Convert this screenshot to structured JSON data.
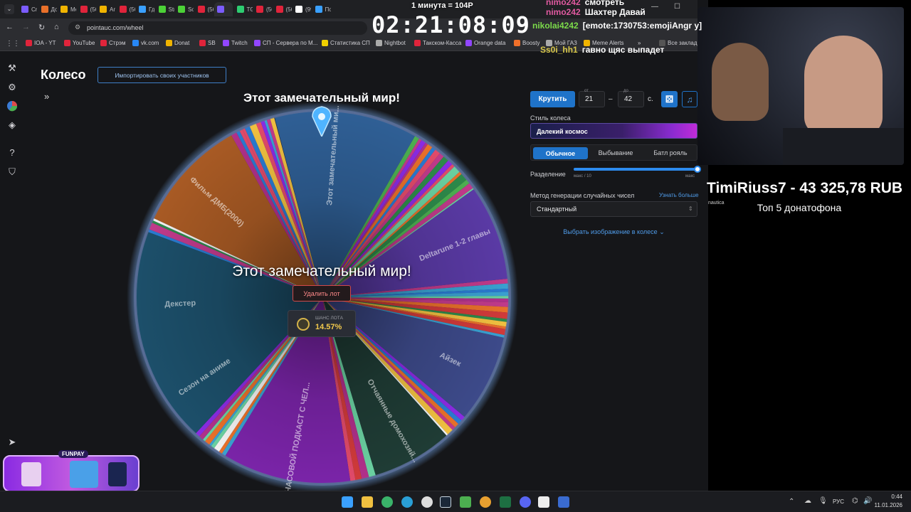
{
  "browser": {
    "tabs": [
      {
        "label": "Crea",
        "color": "#7b5cff"
      },
      {
        "label": "Дон",
        "color": "#e8702a"
      },
      {
        "label": "Mem",
        "color": "#f0b400"
      },
      {
        "label": "(56)",
        "color": "#e0243b"
      },
      {
        "label": "Amn",
        "color": "#f0b400"
      },
      {
        "label": "(56)",
        "color": "#e0243b"
      },
      {
        "label": "Где с",
        "color": "#3aa0ff"
      },
      {
        "label": "Strea",
        "color": "#4cd137"
      },
      {
        "label": "Sopi",
        "color": "#4cd137"
      },
      {
        "label": "(56)",
        "color": "#e0243b"
      },
      {
        "label": "",
        "color": "#7b5cff"
      },
      {
        "label": "TG",
        "color": "#2ecc71"
      },
      {
        "label": "(56)",
        "color": "#e0243b"
      },
      {
        "label": "(56)",
        "color": "#e0243b"
      },
      {
        "label": "(99+",
        "color": "#ffffff"
      },
      {
        "label": "Пол",
        "color": "#3aa0ff"
      }
    ],
    "url": "pointauc.com/wheel",
    "bookmarks": [
      {
        "label": "IOA - YT",
        "color": "#e0243b"
      },
      {
        "label": "YouTube",
        "color": "#e0243b"
      },
      {
        "label": "Стрэм",
        "color": "#e0243b"
      },
      {
        "label": "vk.com",
        "color": "#2787f5"
      },
      {
        "label": "Donat",
        "color": "#f0b400"
      },
      {
        "label": "SB",
        "color": "#e0243b"
      },
      {
        "label": "Twitch",
        "color": "#9146ff"
      },
      {
        "label": "СП - Сервера по М...",
        "color": "#9146ff"
      },
      {
        "label": "Статистика СП",
        "color": "#f0d000"
      },
      {
        "label": "Nightbot",
        "color": "#aaaaaa"
      },
      {
        "label": "Такском-Касса",
        "color": "#e0243b"
      },
      {
        "label": "Orange data",
        "color": "#9146ff"
      },
      {
        "label": "Boosty",
        "color": "#f0702a"
      },
      {
        "label": "Мой ГАЗ",
        "color": "#aaaaaa"
      },
      {
        "label": "Meme Alerts",
        "color": "#f0b400"
      }
    ],
    "bookmarks_all": "Все заклад"
  },
  "rail": {
    "icons": [
      "gavel-icon",
      "gear-icon",
      "wheel-icon",
      "layers-icon",
      "help-icon",
      "shield-icon",
      "telegram-icon"
    ]
  },
  "header": {
    "title": "Колесо",
    "import_button": "Импортировать своих участников",
    "expand_icon": "»"
  },
  "wheel": {
    "winner_top": "Этот замечательный мир!",
    "winner_center": "Этот замечательный мир!",
    "delete_button": "Удалить лот",
    "chance_label": "ШАНС ЛОТА",
    "chance_value": "14.57%",
    "segment_labels": [
      "Этот замечательный ми...",
      "Deltarune 1-2 главы",
      "Айзек",
      "Отчаянные домохозяй...",
      "ЧАСОВОЙ ПОДКАСТ С ЧЕЛ...",
      "Сезон на аниме",
      "Декстер",
      "Фильм ДМБ(2000)"
    ]
  },
  "controls": {
    "spin_button": "Крутить",
    "from_label": "от",
    "from_value": "21",
    "dash": "–",
    "to_label": "до",
    "to_value": "42",
    "seconds": "с.",
    "dice_icon": "dice-icon",
    "music_icon": "music-icon",
    "style_label": "Стиль колеса",
    "style_value": "Далекий космос",
    "modes": [
      "Обычное",
      "Выбывание",
      "Батл рояль"
    ],
    "active_mode": "Обычное",
    "split_label": "Разделение",
    "split_min": "макс / 10",
    "split_max": "макс",
    "split_value": 1.0,
    "rng_label": "Метод генерации случайных чисел",
    "rng_more": "Узнать больше",
    "rng_value": "Стандартный",
    "image_link": "Выбрать изображение в колесе"
  },
  "overlay": {
    "timer": "02:21:08:09",
    "marquee": "1 минута = 104Р",
    "chat": [
      {
        "user": "nimo242",
        "msg": "смотреть",
        "color": "#e05aa0"
      },
      {
        "user": "nimo242",
        "msg": "Шахтер Давай",
        "color": "#e05aa0"
      },
      {
        "user": "nikolai4242",
        "msg": "[emote:1730753:emojiAngr y]",
        "color": "#7cdb4a"
      },
      {
        "user": "Ss0i_hh1",
        "msg": "гавно щяс выпадет",
        "color": "#d8c84a"
      }
    ],
    "donation": "TimiRiuss7 - 43 325,78 RUB",
    "donation_sub": "Топ  5 донатофона",
    "side_tag": "nautica",
    "promo": "FUNPAY"
  },
  "taskbar": {
    "lang": "РУС",
    "time": "0:44",
    "date": "11.01.2026"
  }
}
